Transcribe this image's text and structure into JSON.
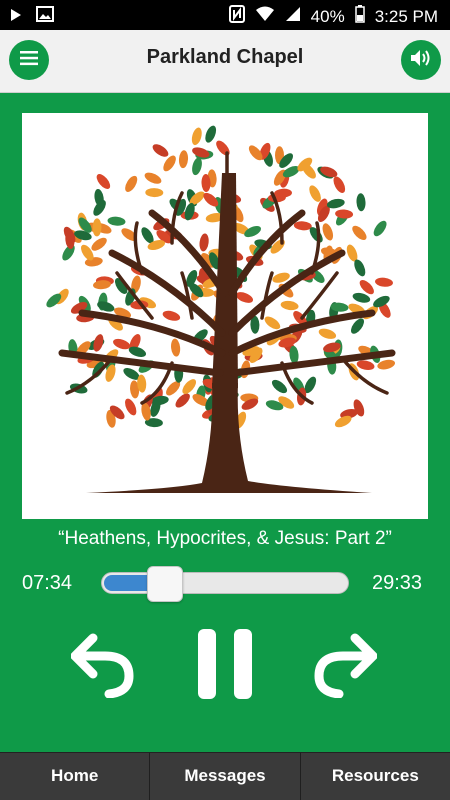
{
  "status_bar": {
    "battery": "40%",
    "time": "3:25 PM",
    "icons": [
      "play-icon",
      "image-icon",
      "nfc-icon",
      "wifi-icon",
      "signal-icon",
      "battery-icon"
    ]
  },
  "header": {
    "title": "Parkland Chapel",
    "menu_icon": "hamburger-menu-icon",
    "volume_icon": "speaker-icon"
  },
  "player": {
    "track_title": "“Heathens, Hypocrites, & Jesus: Part 2”",
    "elapsed": "07:34",
    "duration": "29:33",
    "progress_fraction": 0.256,
    "controls": [
      "rewind-icon",
      "pause-icon",
      "forward-icon"
    ]
  },
  "tabs": [
    {
      "label": "Home"
    },
    {
      "label": "Messages"
    },
    {
      "label": "Resources"
    }
  ],
  "colors": {
    "brand_green": "#0f9a48",
    "slider_fill": "#3d87cf",
    "tab_bar": "#3a3a3a"
  }
}
